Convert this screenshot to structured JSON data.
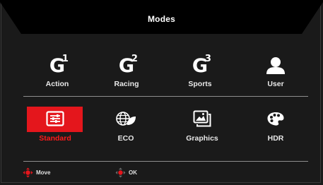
{
  "menu": {
    "title": "Modes"
  },
  "modes": [
    {
      "label": "Action",
      "icon": "g1-icon",
      "number": "1"
    },
    {
      "label": "Racing",
      "icon": "g2-icon",
      "number": "2"
    },
    {
      "label": "Sports",
      "icon": "g3-icon",
      "number": "3"
    },
    {
      "label": "User",
      "icon": "user-icon"
    },
    {
      "label": "Standard",
      "icon": "sliders-icon",
      "selected": true
    },
    {
      "label": "ECO",
      "icon": "globe-leaf-icon"
    },
    {
      "label": "Graphics",
      "icon": "picture-icon"
    },
    {
      "label": "HDR",
      "icon": "palette-icon"
    }
  ],
  "footer": {
    "move_label": "Move",
    "ok_label": "OK"
  },
  "colors": {
    "accent": "#e4161c",
    "background": "#1a1a1a",
    "header": "#000000",
    "text": "#e8e8e8"
  }
}
